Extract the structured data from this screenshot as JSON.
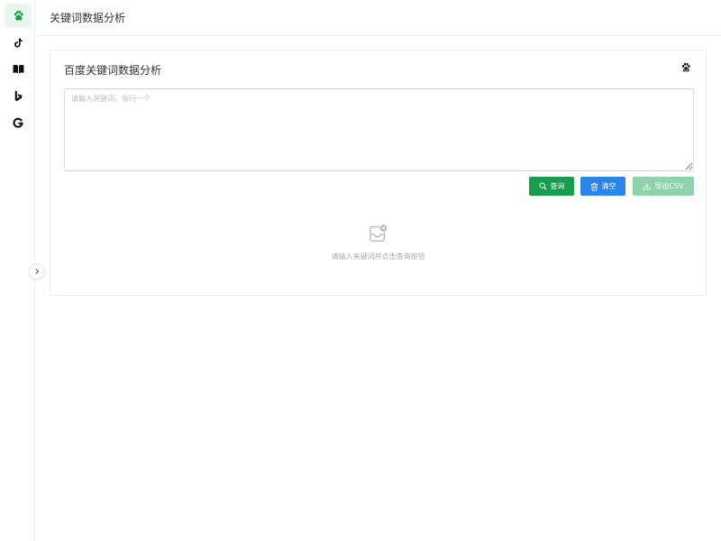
{
  "header": {
    "title": "关键词数据分析"
  },
  "sidebar": {
    "items": [
      {
        "name": "baidu",
        "icon": "baidu-paw-icon",
        "active": true
      },
      {
        "name": "tiktok",
        "icon": "tiktok-icon",
        "active": false
      },
      {
        "name": "book",
        "icon": "book-icon",
        "active": false
      },
      {
        "name": "bing",
        "icon": "bing-icon",
        "active": false
      },
      {
        "name": "google",
        "icon": "google-icon",
        "active": false
      }
    ],
    "collapse_icon": "chevron-right-icon"
  },
  "card": {
    "title": "百度关键词数据分析",
    "icon": "baidu-paw-icon",
    "textarea": {
      "value": "",
      "placeholder": "请输入关键词，每行一个"
    },
    "buttons": {
      "query_label": "查询",
      "clear_label": "清空",
      "export_label": "导出CSV"
    },
    "empty": {
      "icon": "empty-inbox-icon",
      "text": "请输入关键词并点击查询按钮"
    }
  },
  "colors": {
    "accent_green": "#189c4d",
    "active_bg": "#e8f5ec",
    "blue": "#2a84ea",
    "disabled_green": "#8fd1ab"
  }
}
